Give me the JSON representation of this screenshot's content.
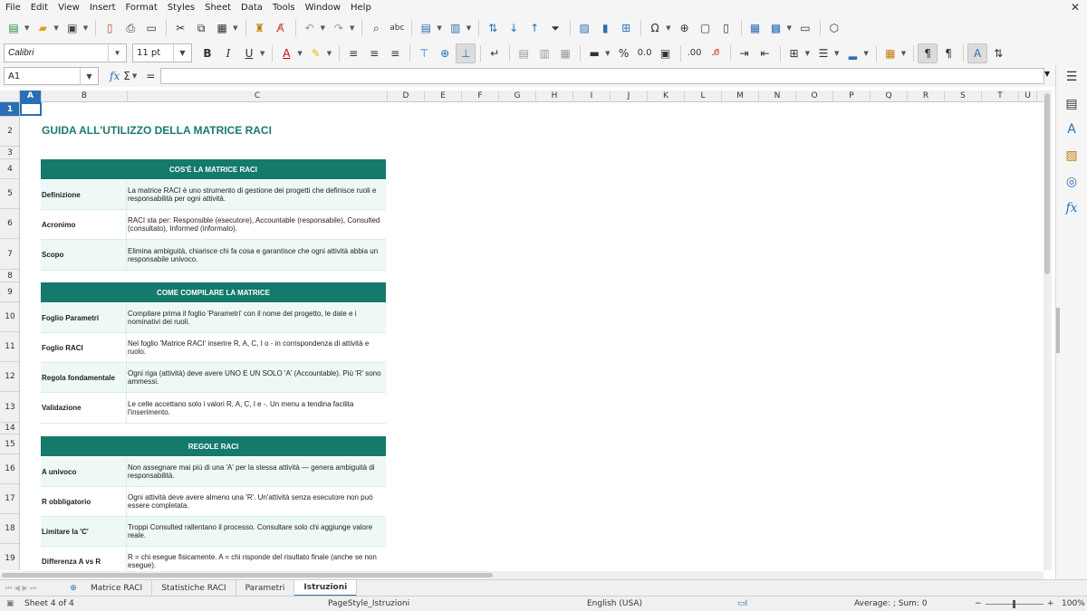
{
  "menu": [
    "File",
    "Edit",
    "View",
    "Insert",
    "Format",
    "Styles",
    "Sheet",
    "Data",
    "Tools",
    "Window",
    "Help"
  ],
  "font": {
    "name": "Calibri",
    "size": "11 pt"
  },
  "formula_bar": {
    "cell_ref": "A1",
    "fx": "fx",
    "sum": "Σ",
    "eq": "=",
    "content": ""
  },
  "columns": [
    {
      "label": "A",
      "w": 24
    },
    {
      "label": "B",
      "w": 95
    },
    {
      "label": "C",
      "w": 287
    },
    {
      "label": "D",
      "w": 41
    },
    {
      "label": "E",
      "w": 41
    },
    {
      "label": "F",
      "w": 41
    },
    {
      "label": "G",
      "w": 41
    },
    {
      "label": "H",
      "w": 41
    },
    {
      "label": "I",
      "w": 41
    },
    {
      "label": "J",
      "w": 41
    },
    {
      "label": "K",
      "w": 41
    },
    {
      "label": "L",
      "w": 41
    },
    {
      "label": "M",
      "w": 41
    },
    {
      "label": "N",
      "w": 41
    },
    {
      "label": "O",
      "w": 41
    },
    {
      "label": "P",
      "w": 41
    },
    {
      "label": "Q",
      "w": 41
    },
    {
      "label": "R",
      "w": 41
    },
    {
      "label": "S",
      "w": 41
    },
    {
      "label": "T",
      "w": 41
    },
    {
      "label": "U",
      "w": 20
    }
  ],
  "rows": [
    "1",
    "2",
    "3",
    "4",
    "5",
    "6",
    "7",
    "8",
    "9",
    "10",
    "11",
    "12",
    "13",
    "14",
    "15",
    "16",
    "17",
    "18",
    "19"
  ],
  "sheet": {
    "title": "GUIDA ALL'UTILIZZO DELLA MATRICE RACI",
    "sections": [
      {
        "header": "COS'È LA MATRICE RACI",
        "rows": [
          {
            "label": "Definizione",
            "text": "La matrice RACI è uno strumento di gestione dei progetti che definisce ruoli e responsabilità per ogni attività."
          },
          {
            "label": "Acronimo",
            "text": "RACI sta per: Responsible (esecutore), Accountable (responsabile), Consulted (consultato), Informed (informato)."
          },
          {
            "label": "Scopo",
            "text": "Elimina ambiguità, chiarisce chi fa cosa e garantisce che ogni attività abbia un responsabile univoco."
          }
        ]
      },
      {
        "header": "COME COMPILARE LA MATRICE",
        "rows": [
          {
            "label": "Foglio Parametri",
            "text": "Compilare prima il foglio 'Parametri' con il nome del progetto, le date e i nominativi dei ruoli."
          },
          {
            "label": "Foglio RACI",
            "text": "Nel foglio 'Matrice RACI' inserire R, A, C, I o - in corrispondenza di attività e ruolo."
          },
          {
            "label": "Regola fondamentale",
            "text": "Ogni riga (attività) deve avere UNO E UN SOLO 'A' (Accountable). Più 'R' sono ammessi."
          },
          {
            "label": "Validazione",
            "text": "Le celle accettano solo i valori R, A, C, I e -. Un menu a tendina facilita l'inserimento."
          }
        ]
      },
      {
        "header": "REGOLE RACI",
        "rows": [
          {
            "label": "A univoco",
            "text": "Non assegnare mai più di una 'A' per la stessa attività — genera ambiguità di responsabilità."
          },
          {
            "label": "R obbligatorio",
            "text": "Ogni attività deve avere almeno una 'R'. Un'attività senza esecutore non può essere completata."
          },
          {
            "label": "Limitare la 'C'",
            "text": "Troppi Consulted rallentano il processo. Consultare solo chi aggiunge valore reale."
          },
          {
            "label": "Differenza A vs R",
            "text": "R = chi esegue fisicamente. A = chi risponde del risultato finale (anche se non esegue)."
          }
        ]
      }
    ]
  },
  "tabs": [
    "Matrice RACI",
    "Statistiche RACI",
    "Parametri",
    "Istruzioni"
  ],
  "active_tab": "Istruzioni",
  "status": {
    "sheet": "Sheet 4 of 4",
    "page_style": "PageStyle_Istruzioni",
    "language": "English (USA)",
    "sum": "Average: ; Sum: 0",
    "zoom": "100%"
  }
}
